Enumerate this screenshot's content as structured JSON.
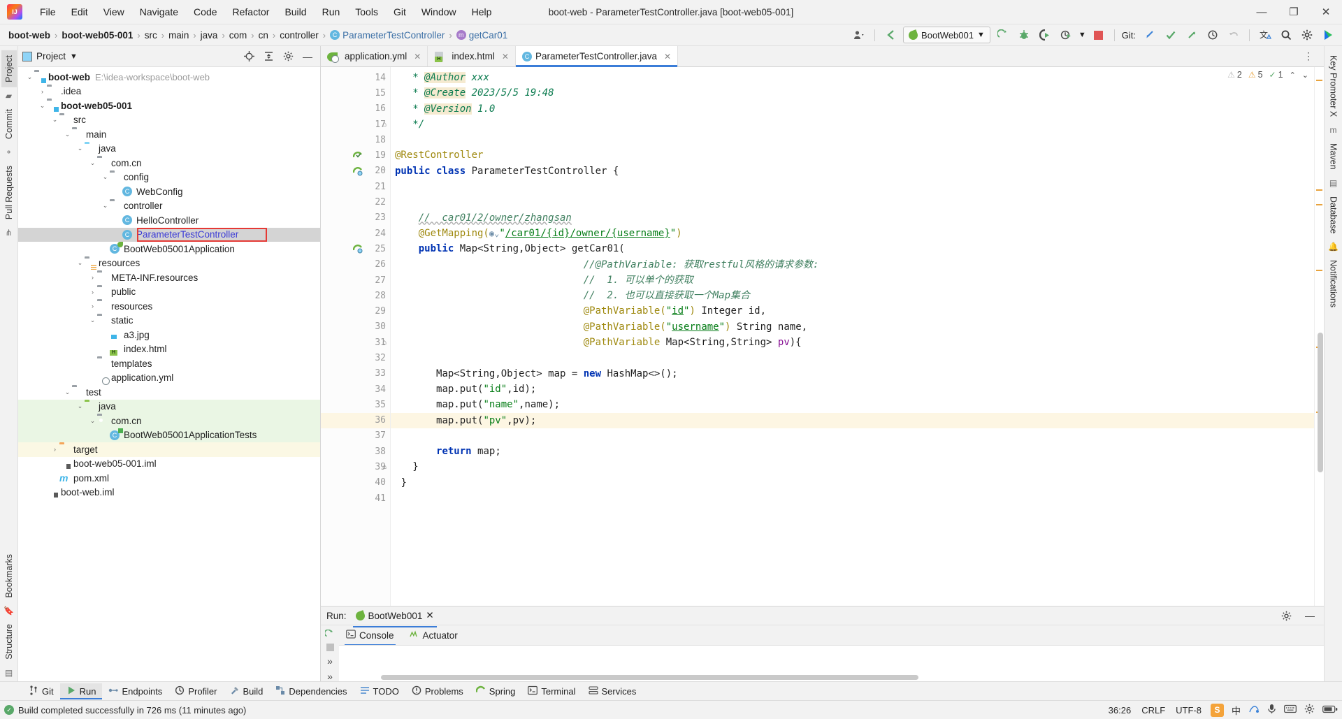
{
  "window": {
    "title": "boot-web - ParameterTestController.java [boot-web05-001]",
    "minimize": "—",
    "maximize": "❐",
    "close": "✕"
  },
  "menu": [
    "File",
    "Edit",
    "View",
    "Navigate",
    "Code",
    "Refactor",
    "Build",
    "Run",
    "Tools",
    "Git",
    "Window",
    "Help"
  ],
  "breadcrumb": [
    {
      "label": "boot-web",
      "bold": true
    },
    {
      "label": "boot-web05-001",
      "bold": true
    },
    {
      "label": "src"
    },
    {
      "label": "main"
    },
    {
      "label": "java"
    },
    {
      "label": "com"
    },
    {
      "label": "cn"
    },
    {
      "label": "controller"
    },
    {
      "label": "ParameterTestController",
      "icon": "class-icon",
      "link": true
    },
    {
      "label": "getCar01",
      "icon": "method-icon",
      "link": true
    }
  ],
  "toolbar": {
    "run_config": "BootWeb001",
    "git_label": "Git:",
    "icons": {
      "profile": "user-profile-icon",
      "back": "navigate-back-icon",
      "run": "run-icon",
      "debug": "debug-icon",
      "coverage": "run-with-coverage-icon",
      "profiler": "profiler-icon",
      "stop": "stop-icon",
      "update": "git-update-icon",
      "commit": "git-commit-icon",
      "push": "git-push-icon",
      "history": "git-history-icon",
      "rollback": "git-rollback-icon",
      "translate": "translate-icon",
      "search": "search-everywhere-icon",
      "settings": "settings-icon",
      "ide": "ide-feature-icon"
    }
  },
  "left_stripe": [
    "Project",
    "Commit",
    "Pull Requests",
    "Bookmarks",
    "Structure"
  ],
  "right_stripe": [
    "Key Promoter X",
    "Maven",
    "Database",
    "Notifications"
  ],
  "project_panel": {
    "title": "Project",
    "head_icons": [
      "locate-icon",
      "collapse-all-icon",
      "settings-icon",
      "hide-icon"
    ],
    "tree": [
      {
        "indent": 0,
        "arrow": "v",
        "icon": "module-folder-icon",
        "label": "boot-web",
        "bold": true,
        "path": "E:\\idea-workspace\\boot-web"
      },
      {
        "indent": 1,
        "arrow": ">",
        "icon": "folder-icon",
        "label": ".idea"
      },
      {
        "indent": 1,
        "arrow": "v",
        "icon": "module-folder-icon",
        "label": "boot-web05-001",
        "bold": true
      },
      {
        "indent": 2,
        "arrow": "v",
        "icon": "folder-icon",
        "label": "src"
      },
      {
        "indent": 3,
        "arrow": "v",
        "icon": "folder-icon",
        "label": "main"
      },
      {
        "indent": 4,
        "arrow": "v",
        "icon": "source-folder-icon",
        "label": "java"
      },
      {
        "indent": 5,
        "arrow": "v",
        "icon": "package-icon",
        "label": "com.cn"
      },
      {
        "indent": 6,
        "arrow": "v",
        "icon": "package-icon",
        "label": "config"
      },
      {
        "indent": 7,
        "arrow": "",
        "icon": "class-icon",
        "label": "WebConfig"
      },
      {
        "indent": 6,
        "arrow": "v",
        "icon": "package-icon",
        "label": "controller"
      },
      {
        "indent": 7,
        "arrow": "",
        "icon": "class-icon",
        "label": "HelloController"
      },
      {
        "indent": 7,
        "arrow": "",
        "icon": "class-icon",
        "label": "ParameterTestController",
        "selected": true,
        "boxed": true,
        "blue": true
      },
      {
        "indent": 6,
        "arrow": "",
        "icon": "spring-class-icon",
        "label": "BootWeb05001Application"
      },
      {
        "indent": 4,
        "arrow": "v",
        "icon": "resources-folder-icon",
        "label": "resources"
      },
      {
        "indent": 5,
        "arrow": ">",
        "icon": "folder-icon",
        "label": "META-INF.resources"
      },
      {
        "indent": 5,
        "arrow": ">",
        "icon": "folder-icon",
        "label": "public"
      },
      {
        "indent": 5,
        "arrow": ">",
        "icon": "folder-icon",
        "label": "resources"
      },
      {
        "indent": 5,
        "arrow": "v",
        "icon": "folder-icon",
        "label": "static"
      },
      {
        "indent": 6,
        "arrow": "",
        "icon": "image-file-icon",
        "label": "a3.jpg"
      },
      {
        "indent": 6,
        "arrow": "",
        "icon": "html-file-icon",
        "label": "index.html"
      },
      {
        "indent": 5,
        "arrow": "",
        "icon": "folder-icon",
        "label": "templates"
      },
      {
        "indent": 5,
        "arrow": "",
        "icon": "yaml-spring-file-icon",
        "label": "application.yml"
      },
      {
        "indent": 3,
        "arrow": "v",
        "icon": "folder-icon",
        "label": "test"
      },
      {
        "indent": 4,
        "arrow": "v",
        "icon": "test-source-folder-icon",
        "label": "java",
        "greenbg": true
      },
      {
        "indent": 5,
        "arrow": "v",
        "icon": "package-icon",
        "label": "com.cn",
        "greenbg": true
      },
      {
        "indent": 6,
        "arrow": "",
        "icon": "test-class-icon",
        "label": "BootWeb05001ApplicationTests",
        "greenbg": true
      },
      {
        "indent": 2,
        "arrow": ">",
        "icon": "excluded-folder-icon",
        "label": "target",
        "yellowbg": true
      },
      {
        "indent": 2,
        "arrow": "",
        "icon": "iml-file-icon",
        "label": "boot-web05-001.iml"
      },
      {
        "indent": 2,
        "arrow": "",
        "icon": "maven-file-icon",
        "label": "pom.xml"
      },
      {
        "indent": 1,
        "arrow": "",
        "icon": "iml-file-icon",
        "label": "boot-web.iml"
      }
    ]
  },
  "editor": {
    "tabs": [
      {
        "label": "application.yml",
        "icon": "yaml-spring-file-icon",
        "active": false
      },
      {
        "label": "index.html",
        "icon": "html-file-icon",
        "active": false
      },
      {
        "label": "ParameterTestController.java",
        "icon": "class-icon",
        "active": true
      }
    ],
    "inspection": {
      "warnings": "2",
      "weak_warnings": "5",
      "typos": "1",
      "collapse": "⌃",
      "expand": "⌄"
    },
    "first_line_number": 14,
    "lines": [
      {
        "n": 14,
        "html": "   <span class='jdoc'>* </span><span class='jdoc-tag'>@Author</span><span class='jdoc'> xxx</span>"
      },
      {
        "n": 15,
        "html": "   <span class='jdoc'>* </span><span class='jdoc-tag'>@Create</span><span class='jdoc'> 2023/5/5 19:48</span>"
      },
      {
        "n": 16,
        "html": "   <span class='jdoc'>* </span><span class='jdoc-tag'>@Version</span><span class='jdoc'> 1.0</span>",
        "fold": false
      },
      {
        "n": 17,
        "html": "   <span class='jdoc'>*/</span>",
        "fold": true
      },
      {
        "n": 18,
        "html": ""
      },
      {
        "n": 19,
        "html": "<span class='anno'>@RestController</span>",
        "mark": "spring-bean-icon"
      },
      {
        "n": 20,
        "html": "<span class='kw'>public class </span><span class='ident'>ParameterTestController </span><span class='ident'>{</span>",
        "mark": "spring-endpoint-icon"
      },
      {
        "n": 21,
        "html": ""
      },
      {
        "n": 22,
        "html": ""
      },
      {
        "n": 23,
        "html": "    <span class='cmt-green wavy'>//  car01/2/owner/zhangsan</span>"
      },
      {
        "n": 24,
        "html": "    <span class='anno'>@GetMapping(</span><span class='globe'>&#9673;&#8964;</span><span class='str'>\"</span><span class='str ulink'>/car01/{id}/owner/{username}</span><span class='str'>\"</span><span class='anno'>)</span>"
      },
      {
        "n": 25,
        "html": "    <span class='kw'>public </span><span class='ident'>Map&lt;String,Object&gt; getCar01(</span>",
        "mark": "spring-endpoint-icon"
      },
      {
        "n": 26,
        "html": "                                <span class='cmt-green'>//@PathVariable: 获取restful风格的请求参数:</span>"
      },
      {
        "n": 27,
        "html": "                                <span class='cmt-green'>//  1. 可以单个的获取</span>"
      },
      {
        "n": 28,
        "html": "                                <span class='cmt-green'>//  2. 也可以直接获取一个Map集合</span>"
      },
      {
        "n": 29,
        "html": "                                <span class='anno'>@PathVariable(</span><span class='str'>\"</span><span class='str ulink'>id</span><span class='str'>\"</span><span class='anno'>) </span><span class='ident'>Integer id,</span>"
      },
      {
        "n": 30,
        "html": "                                <span class='anno'>@PathVariable(</span><span class='str'>\"</span><span class='str ulink'>username</span><span class='str'>\"</span><span class='anno'>) </span><span class='ident'>String name,</span>"
      },
      {
        "n": 31,
        "html": "                                <span class='anno'>@PathVariable </span><span class='ident'>Map&lt;String,String&gt; </span><span class='field'>pv</span><span class='ident'>){</span>",
        "fold": true
      },
      {
        "n": 32,
        "html": ""
      },
      {
        "n": 33,
        "html": "       <span class='ident'>Map&lt;String,Object&gt; map = </span><span class='kw'>new </span><span class='ident'>HashMap&lt;&gt;();</span>"
      },
      {
        "n": 34,
        "html": "       <span class='ident'>map.put(</span><span class='str'>\"id\"</span><span class='ident'>,id);</span>"
      },
      {
        "n": 35,
        "html": "       <span class='ident'>map.put(</span><span class='str'>\"name\"</span><span class='ident'>,name);</span>"
      },
      {
        "n": 36,
        "html": "       <span class='ident'>map.put(</span><span class='str'>\"pv\"</span><span class='ident'>,pv);</span>",
        "current": true,
        "bulb": true
      },
      {
        "n": 37,
        "html": ""
      },
      {
        "n": 38,
        "html": "       <span class='kw'>return </span><span class='ident'>map;</span>"
      },
      {
        "n": 39,
        "html": "   <span class='ident'>}</span>",
        "fold": true
      },
      {
        "n": 40,
        "html": " <span class='ident'>}</span>"
      },
      {
        "n": 41,
        "html": ""
      }
    ]
  },
  "run_window": {
    "label": "Run:",
    "config_name": "BootWeb001",
    "close": "✕",
    "tabs": [
      {
        "label": "Console",
        "icon": "console-icon",
        "active": true
      },
      {
        "label": "Actuator",
        "icon": "actuator-icon",
        "active": false
      }
    ],
    "head_icons": [
      "settings-icon",
      "hide-icon"
    ],
    "sidebar_icons": [
      "rerun-icon",
      "stop-icon",
      "expand-icon"
    ]
  },
  "bottom_toolbar": [
    {
      "label": "Git",
      "icon": "git-icon",
      "active": false
    },
    {
      "label": "Run",
      "icon": "run-icon",
      "active": true
    },
    {
      "label": "Endpoints",
      "icon": "endpoints-icon",
      "active": false
    },
    {
      "label": "Profiler",
      "icon": "profiler-icon",
      "active": false
    },
    {
      "label": "Build",
      "icon": "build-icon",
      "active": false
    },
    {
      "label": "Dependencies",
      "icon": "dependencies-icon",
      "active": false
    },
    {
      "label": "TODO",
      "icon": "todo-icon",
      "active": false
    },
    {
      "label": "Problems",
      "icon": "problems-icon",
      "active": false
    },
    {
      "label": "Spring",
      "icon": "spring-icon",
      "active": false
    },
    {
      "label": "Terminal",
      "icon": "terminal-icon",
      "active": false
    },
    {
      "label": "Services",
      "icon": "services-icon",
      "active": false
    }
  ],
  "statusbar": {
    "message": "Build completed successfully in 726 ms (11 minutes ago)",
    "caret": "36:26",
    "line_separator": "CRLF",
    "encoding": "UTF-8",
    "ime_lang": "中",
    "tray_icons": [
      "snipaste-icon",
      "ime-icon",
      "pinyin-icon",
      "microphone-icon",
      "keyboard-icon",
      "settings-icon",
      "battery-icon"
    ]
  }
}
